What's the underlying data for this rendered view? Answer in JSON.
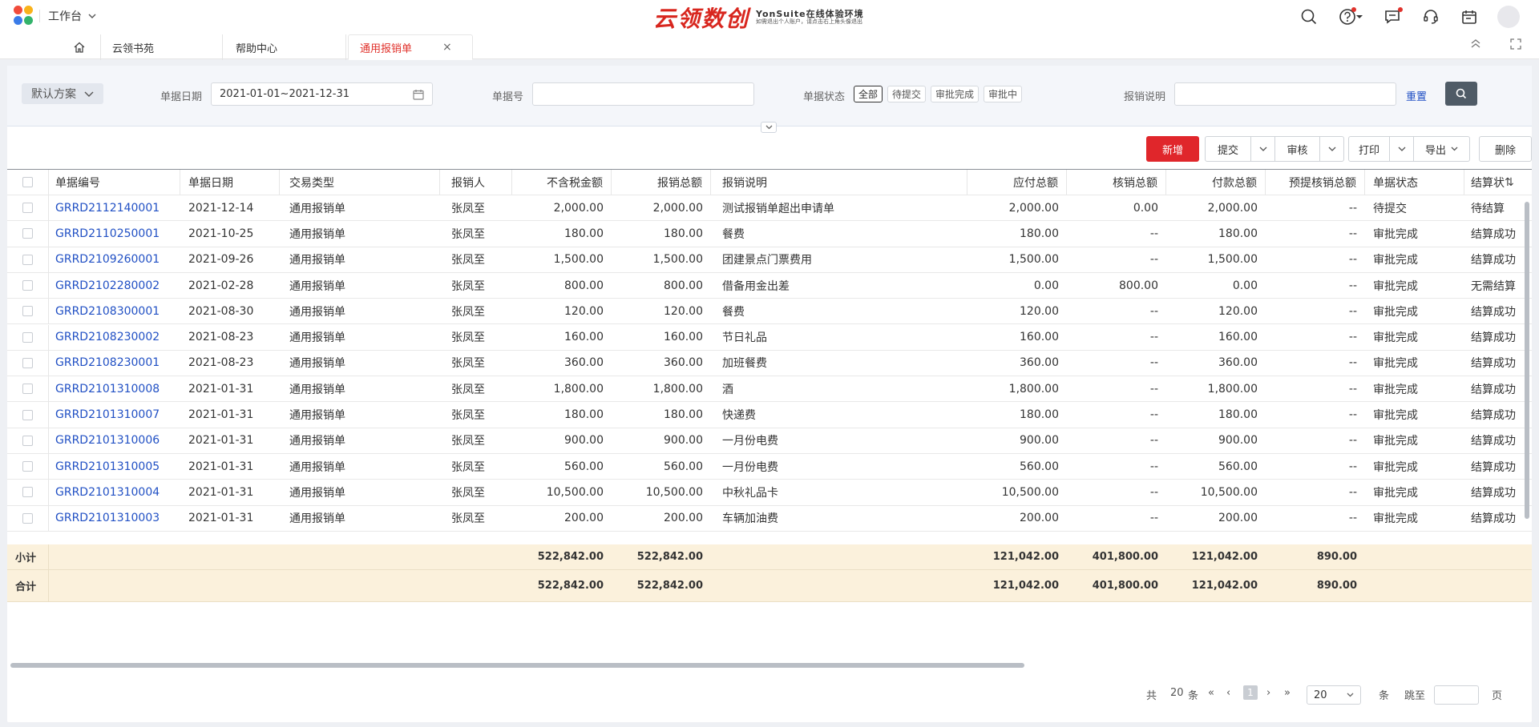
{
  "topbar": {
    "workspace_label": "工作台",
    "brand_main": "云领数创",
    "brand_sub_a": "YonSuite在线体验环境",
    "brand_sub_b": "如需退出个人账户，请点击右上角头像退出",
    "icons": [
      "search-icon",
      "help-icon",
      "message-icon",
      "customer-service-icon",
      "calendar-icon",
      "avatar"
    ]
  },
  "tabs": [
    {
      "label": "云领书苑"
    },
    {
      "label": "帮助中心"
    },
    {
      "label": "通用报销单",
      "active": true
    }
  ],
  "filter": {
    "scheme": "默认方案",
    "date_label": "单据日期",
    "date_value": "2021-01-01~2021-12-31",
    "code_label": "单据号",
    "code_value": "",
    "status_label": "单据状态",
    "status_chips": [
      "全部",
      "待提交",
      "审批完成",
      "审批中"
    ],
    "status_active": "全部",
    "desc_label": "报销说明",
    "desc_value": "",
    "reset": "重置"
  },
  "toolbar": {
    "add": "新增",
    "submit": "提交",
    "audit": "审核",
    "print": "打印",
    "export": "导出",
    "delete": "删除"
  },
  "table": {
    "headers": [
      "单据编号",
      "单据日期",
      "交易类型",
      "报销人",
      "不含税金额",
      "报销总额",
      "报销说明",
      "应付总额",
      "核销总额",
      "付款总额",
      "预提核销总额",
      "单据状态",
      "结算状"
    ],
    "rows": [
      [
        "GRRD2112140001",
        "2021-12-14",
        "通用报销单",
        "张凤至",
        "2,000.00",
        "2,000.00",
        "测试报销单超出申请单",
        "2,000.00",
        "0.00",
        "2,000.00",
        "--",
        "待提交",
        "待结算"
      ],
      [
        "GRRD2110250001",
        "2021-10-25",
        "通用报销单",
        "张凤至",
        "180.00",
        "180.00",
        "餐费",
        "180.00",
        "--",
        "180.00",
        "--",
        "审批完成",
        "结算成功"
      ],
      [
        "GRRD2109260001",
        "2021-09-26",
        "通用报销单",
        "张凤至",
        "1,500.00",
        "1,500.00",
        "团建景点门票费用",
        "1,500.00",
        "--",
        "1,500.00",
        "--",
        "审批完成",
        "结算成功"
      ],
      [
        "GRRD2102280002",
        "2021-02-28",
        "通用报销单",
        "张凤至",
        "800.00",
        "800.00",
        "借备用金出差",
        "0.00",
        "800.00",
        "0.00",
        "--",
        "审批完成",
        "无需结算"
      ],
      [
        "GRRD2108300001",
        "2021-08-30",
        "通用报销单",
        "张凤至",
        "120.00",
        "120.00",
        "餐费",
        "120.00",
        "--",
        "120.00",
        "--",
        "审批完成",
        "结算成功"
      ],
      [
        "GRRD2108230002",
        "2021-08-23",
        "通用报销单",
        "张凤至",
        "160.00",
        "160.00",
        "节日礼品",
        "160.00",
        "--",
        "160.00",
        "--",
        "审批完成",
        "结算成功"
      ],
      [
        "GRRD2108230001",
        "2021-08-23",
        "通用报销单",
        "张凤至",
        "360.00",
        "360.00",
        "加班餐费",
        "360.00",
        "--",
        "360.00",
        "--",
        "审批完成",
        "结算成功"
      ],
      [
        "GRRD2101310008",
        "2021-01-31",
        "通用报销单",
        "张凤至",
        "1,800.00",
        "1,800.00",
        "酒",
        "1,800.00",
        "--",
        "1,800.00",
        "--",
        "审批完成",
        "结算成功"
      ],
      [
        "GRRD2101310007",
        "2021-01-31",
        "通用报销单",
        "张凤至",
        "180.00",
        "180.00",
        "快递费",
        "180.00",
        "--",
        "180.00",
        "--",
        "审批完成",
        "结算成功"
      ],
      [
        "GRRD2101310006",
        "2021-01-31",
        "通用报销单",
        "张凤至",
        "900.00",
        "900.00",
        "一月份电费",
        "900.00",
        "--",
        "900.00",
        "--",
        "审批完成",
        "结算成功"
      ],
      [
        "GRRD2101310005",
        "2021-01-31",
        "通用报销单",
        "张凤至",
        "560.00",
        "560.00",
        "一月份电费",
        "560.00",
        "--",
        "560.00",
        "--",
        "审批完成",
        "结算成功"
      ],
      [
        "GRRD2101310004",
        "2021-01-31",
        "通用报销单",
        "张凤至",
        "10,500.00",
        "10,500.00",
        "中秋礼品卡",
        "10,500.00",
        "--",
        "10,500.00",
        "--",
        "审批完成",
        "结算成功"
      ],
      [
        "GRRD2101310003",
        "2021-01-31",
        "通用报销单",
        "张凤至",
        "200.00",
        "200.00",
        "车辆加油费",
        "200.00",
        "--",
        "200.00",
        "--",
        "审批完成",
        "结算成功"
      ]
    ],
    "subtotal": {
      "label": "小计",
      "untaxed": "522,842.00",
      "total": "522,842.00",
      "payable": "121,042.00",
      "writeoff": "401,800.00",
      "payment": "121,042.00",
      "accrued": "890.00"
    },
    "grand_total": {
      "label": "合计",
      "untaxed": "522,842.00",
      "total": "522,842.00",
      "payable": "121,042.00",
      "writeoff": "401,800.00",
      "payment": "121,042.00",
      "accrued": "890.00"
    }
  },
  "pagination": {
    "total_prefix": "共",
    "total_count": "20",
    "total_suffix": "条",
    "current_page": "1",
    "page_size": "20",
    "size_suffix": "条",
    "jump_label": "跳至",
    "jump_suffix": "页"
  },
  "colors": {
    "accent_red": "#e0262b",
    "link_blue": "#2150c4",
    "footer_bg": "#fbf1dc"
  }
}
